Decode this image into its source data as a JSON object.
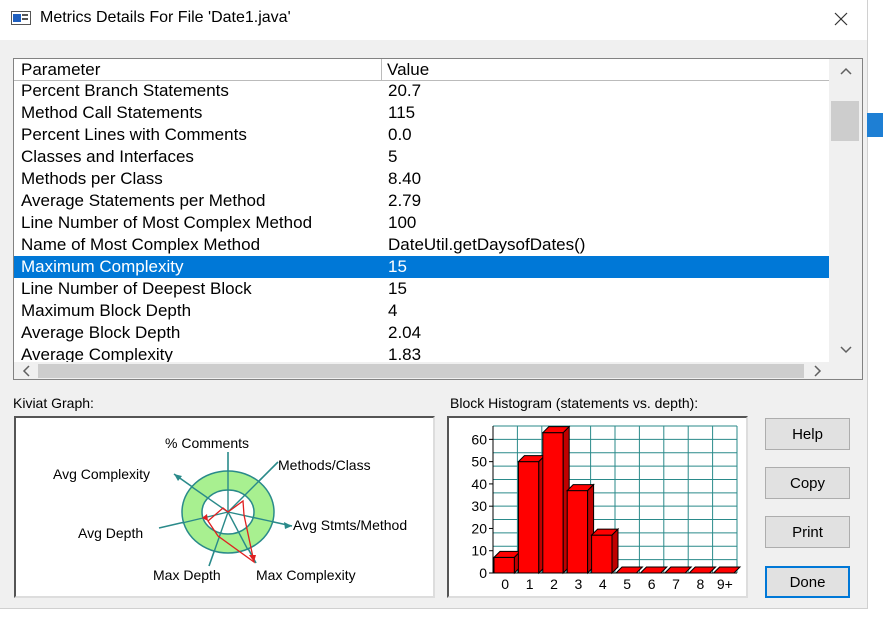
{
  "window": {
    "title": "Metrics Details For File 'Date1.java'",
    "close_icon": "close-icon",
    "app_icon": "window-icon"
  },
  "table": {
    "headers": {
      "parameter": "Parameter",
      "value": "Value"
    },
    "rows": [
      {
        "param": "Percent Branch Statements",
        "value": "20.7"
      },
      {
        "param": "Method Call Statements",
        "value": "115"
      },
      {
        "param": "Percent Lines with Comments",
        "value": "0.0"
      },
      {
        "param": "Classes and Interfaces",
        "value": "5"
      },
      {
        "param": "Methods per Class",
        "value": "8.40"
      },
      {
        "param": "Average Statements per Method",
        "value": "2.79"
      },
      {
        "param": "Line Number of Most Complex Method",
        "value": "100"
      },
      {
        "param": "Name of Most Complex Method",
        "value": "DateUtil.getDaysofDates()"
      },
      {
        "param": "Maximum Complexity",
        "value": "15"
      },
      {
        "param": "Line Number of Deepest Block",
        "value": "15"
      },
      {
        "param": "Maximum Block Depth",
        "value": "4"
      },
      {
        "param": "Average Block Depth",
        "value": "2.04"
      },
      {
        "param": "Average Complexity",
        "value": "1.83"
      }
    ],
    "selected_index": 8,
    "selection_color": "#0078d7"
  },
  "kiviat": {
    "label": "Kiviat Graph:",
    "axes": {
      "comments": "% Comments",
      "methods_class": "Methods/Class",
      "avg_stmts": "Avg Stmts/Method",
      "max_complexity": "Max Complexity",
      "max_depth": "Max Depth",
      "avg_depth": "Avg Depth",
      "avg_complexity": "Avg Complexity"
    },
    "ring_color": "#a8f090",
    "spoke_color": "#2a8a8a"
  },
  "histogram": {
    "label": "Block Histogram (statements vs. depth):",
    "bar_color": "#ff0000",
    "grid_color": "#2a8a8a"
  },
  "chart_data": {
    "type": "bar",
    "categories": [
      "0",
      "1",
      "2",
      "3",
      "4",
      "5",
      "6",
      "7",
      "8",
      "9+"
    ],
    "values": [
      7,
      50,
      63,
      37,
      17,
      0,
      0,
      0,
      0,
      0
    ],
    "ylim": [
      0,
      66
    ],
    "yticks": [
      "0",
      "10",
      "20",
      "30",
      "40",
      "50",
      "60"
    ],
    "grid": true
  },
  "buttons": {
    "help": "Help",
    "copy": "Copy",
    "print": "Print",
    "done": "Done"
  }
}
